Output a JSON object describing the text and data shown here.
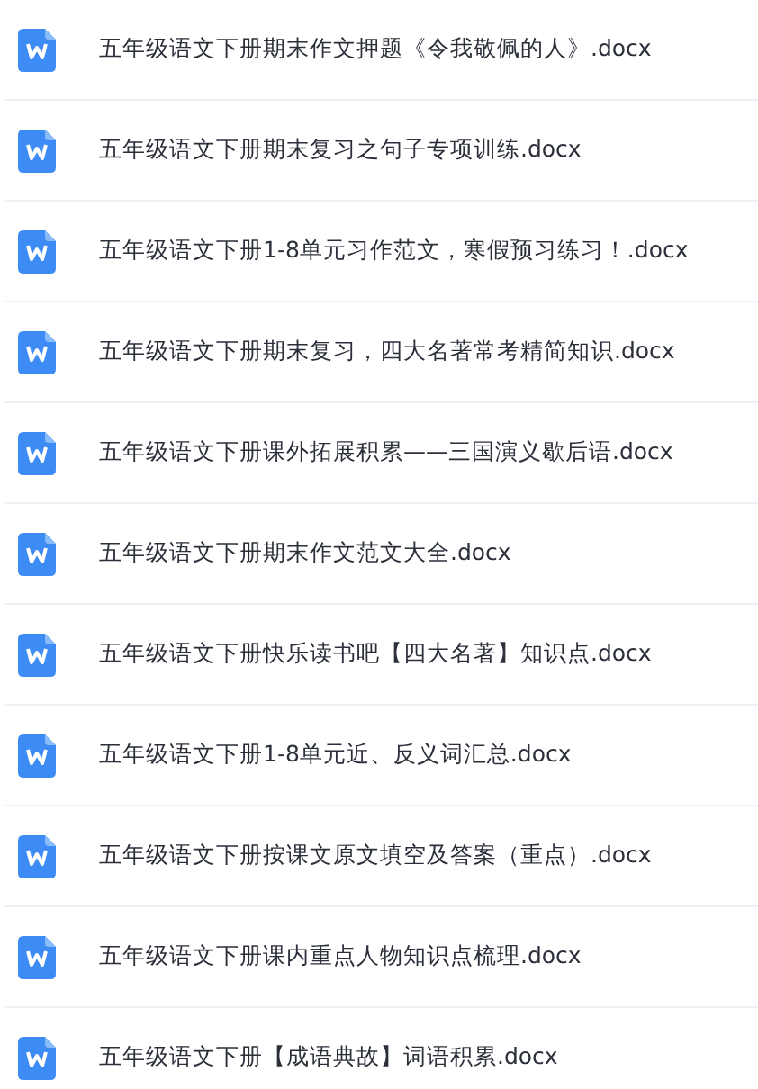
{
  "files": [
    {
      "name": "五年级语文下册期末作文押题《令我敬佩的人》.docx"
    },
    {
      "name": "五年级语文下册期末复习之句子专项训练.docx"
    },
    {
      "name": "五年级语文下册1-8单元习作范文，寒假预习练习！.docx"
    },
    {
      "name": "五年级语文下册期末复习，四大名著常考精简知识.docx"
    },
    {
      "name": "五年级语文下册课外拓展积累——三国演义歇后语.docx"
    },
    {
      "name": "五年级语文下册期末作文范文大全.docx"
    },
    {
      "name": "五年级语文下册快乐读书吧【四大名著】知识点.docx"
    },
    {
      "name": "五年级语文下册1-8单元近、反义词汇总.docx"
    },
    {
      "name": "五年级语文下册按课文原文填空及答案（重点）.docx"
    },
    {
      "name": "五年级语文下册课内重点人物知识点梳理.docx"
    },
    {
      "name": "五年级语文下册【成语典故】词语积累.docx"
    }
  ]
}
